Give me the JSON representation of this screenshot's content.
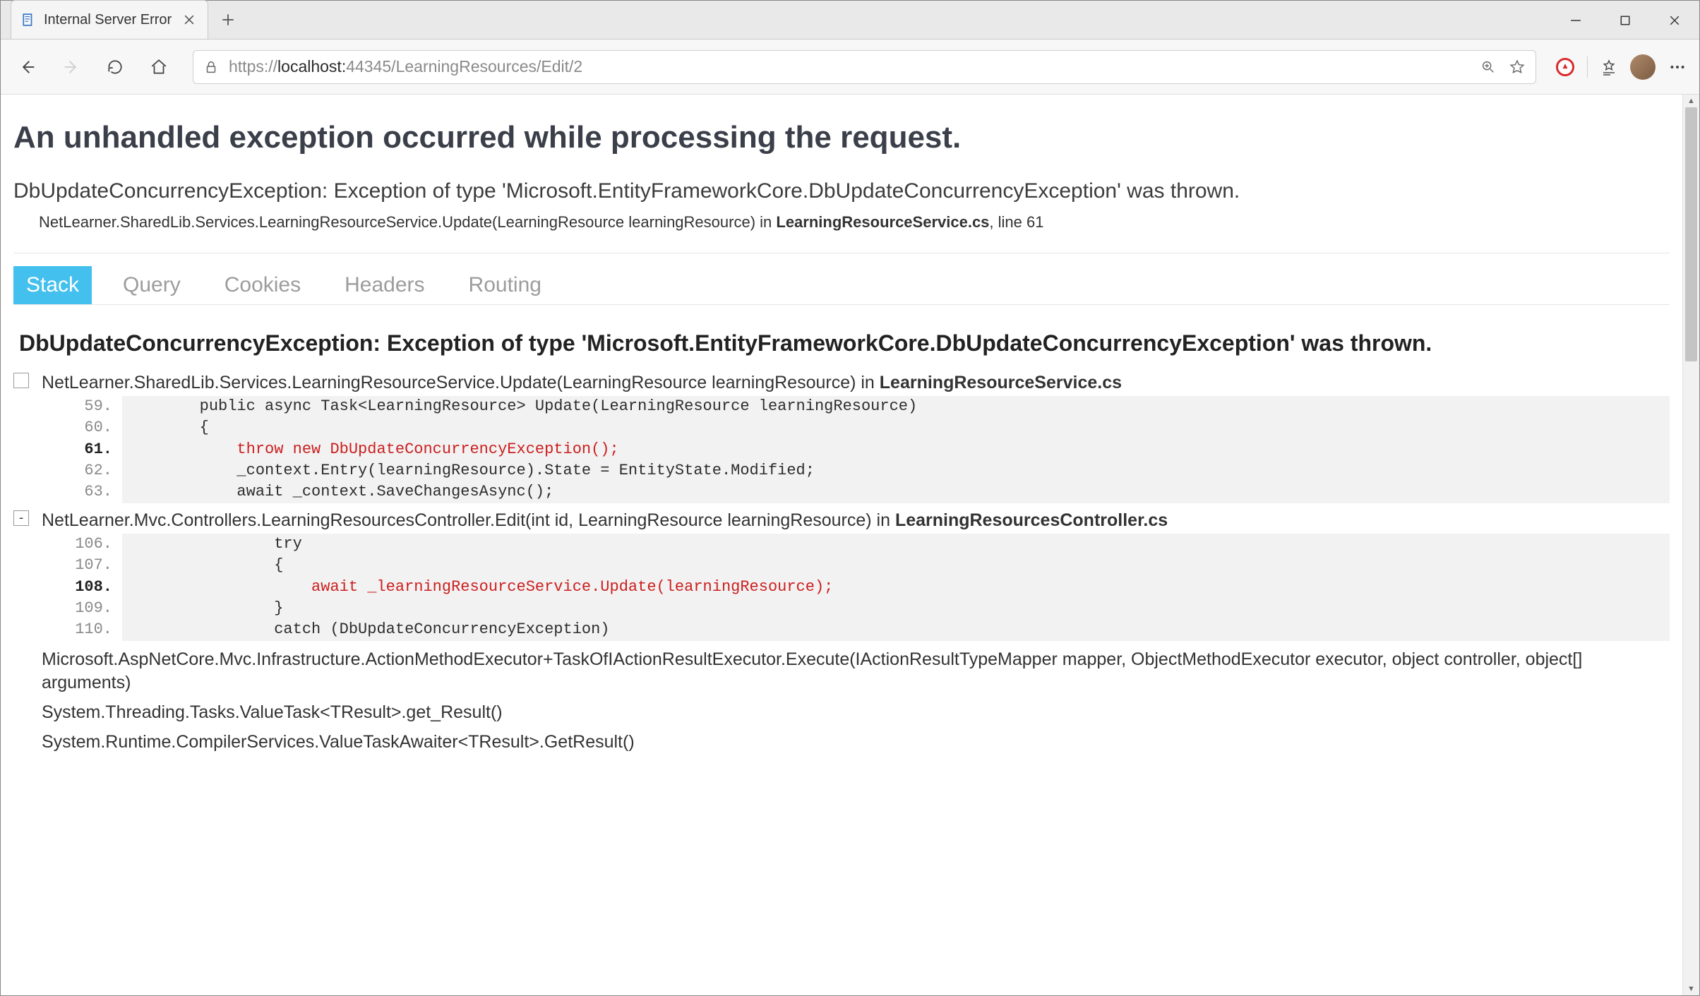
{
  "window": {
    "tab_title": "Internal Server Error",
    "address_prefix": "https://",
    "address_host": "localhost:",
    "address_port_path": "44345/LearningResources/Edit/2"
  },
  "page": {
    "heading": "An unhandled exception occurred while processing the request.",
    "exception_summary": "DbUpdateConcurrencyException: Exception of type 'Microsoft.EntityFrameworkCore.DbUpdateConcurrencyException' was thrown.",
    "exception_location_prefix": "NetLearner.SharedLib.Services.LearningResourceService.Update(LearningResource learningResource) in ",
    "exception_location_file": "LearningResourceService.cs",
    "exception_location_suffix": ", line 61",
    "detail_heading": "DbUpdateConcurrencyException: Exception of type 'Microsoft.EntityFrameworkCore.DbUpdateConcurrencyException' was thrown."
  },
  "tabs": {
    "stack": "Stack",
    "query": "Query",
    "cookies": "Cookies",
    "headers": "Headers",
    "routing": "Routing"
  },
  "frames": [
    {
      "head_prefix": "NetLearner.SharedLib.Services.LearningResourceService.Update(LearningResource learningResource) in ",
      "head_file": "LearningResourceService.cs",
      "toggle": "",
      "lines": [
        {
          "n": "59.",
          "hl": false,
          "err": false,
          "code": "        public async Task<LearningResource> Update(LearningResource learningResource)"
        },
        {
          "n": "60.",
          "hl": false,
          "err": false,
          "code": "        {"
        },
        {
          "n": "61.",
          "hl": true,
          "err": true,
          "code": "            throw new DbUpdateConcurrencyException();"
        },
        {
          "n": "62.",
          "hl": false,
          "err": false,
          "code": "            _context.Entry(learningResource).State = EntityState.Modified;"
        },
        {
          "n": "63.",
          "hl": false,
          "err": false,
          "code": "            await _context.SaveChangesAsync();"
        }
      ]
    },
    {
      "head_prefix": "NetLearner.Mvc.Controllers.LearningResourcesController.Edit(int id, LearningResource learningResource) in ",
      "head_file": "LearningResourcesController.cs",
      "toggle": "-",
      "lines": [
        {
          "n": "106.",
          "hl": false,
          "err": false,
          "code": "                try"
        },
        {
          "n": "107.",
          "hl": false,
          "err": false,
          "code": "                {"
        },
        {
          "n": "108.",
          "hl": true,
          "err": true,
          "code": "                    await _learningResourceService.Update(learningResource);"
        },
        {
          "n": "109.",
          "hl": false,
          "err": false,
          "code": "                }"
        },
        {
          "n": "110.",
          "hl": false,
          "err": false,
          "code": "                catch (DbUpdateConcurrencyException)"
        }
      ]
    }
  ],
  "stack_tail": [
    "Microsoft.AspNetCore.Mvc.Infrastructure.ActionMethodExecutor+TaskOfIActionResultExecutor.Execute(IActionResultTypeMapper mapper, ObjectMethodExecutor executor, object controller, object[] arguments)",
    "System.Threading.Tasks.ValueTask<TResult>.get_Result()",
    "System.Runtime.CompilerServices.ValueTaskAwaiter<TResult>.GetResult()"
  ]
}
